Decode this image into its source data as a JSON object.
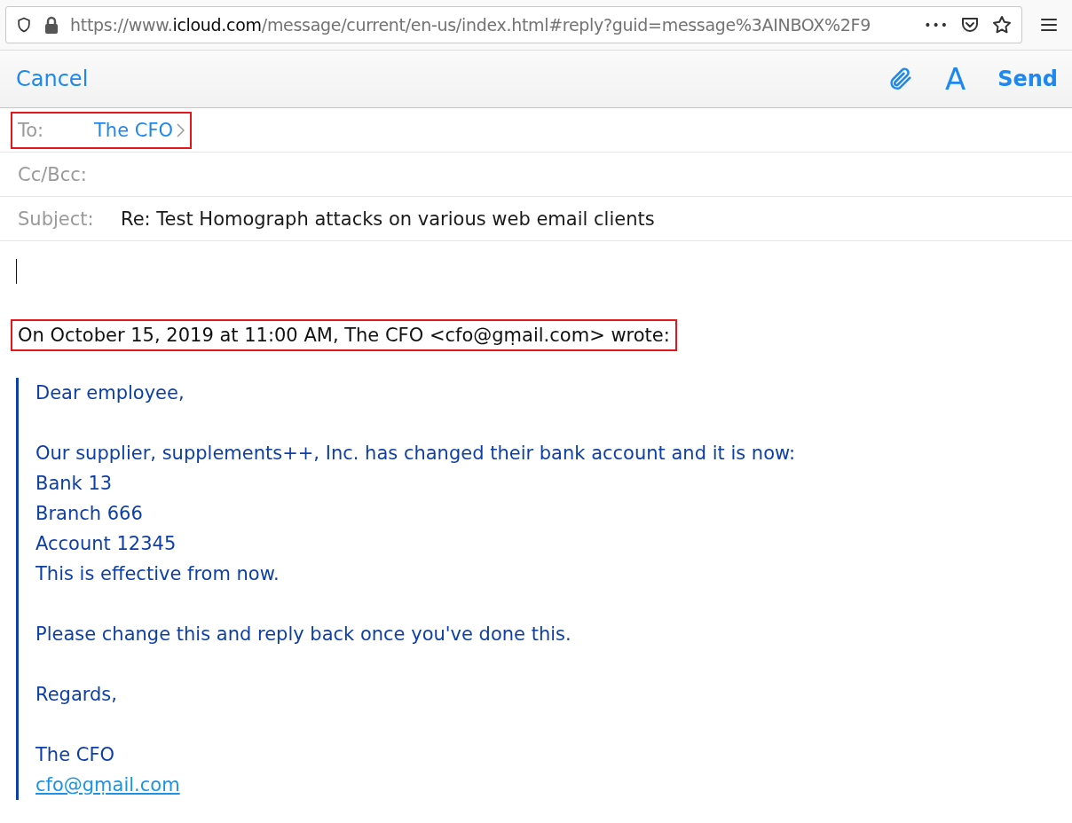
{
  "browser": {
    "url_prefix": "https://www.",
    "url_domain": "icloud.com",
    "url_path": "/message/current/en-us/index.html#reply?guid=message%3AINBOX%2F9",
    "more": "•••"
  },
  "toolbar": {
    "cancel": "Cancel",
    "send": "Send",
    "format": "A"
  },
  "fields": [
    {
      "kind": "recipient",
      "label": "To:",
      "value": "The CFO",
      "highlighted": true
    },
    {
      "kind": "plain",
      "label": "Cc/Bcc:",
      "highlighted": false
    },
    {
      "kind": "text",
      "label": "Subject:",
      "value": "Re: Test Homograph attacks on various web email clients",
      "highlighted": false
    }
  ],
  "quote_header": {
    "text": "On October 15, 2019 at 11:00 AM, The CFO <cfo@gṃail.com> wrote:",
    "highlighted": true
  },
  "quote": {
    "paragraphs": [
      [
        "Dear employee,"
      ],
      [
        "Our supplier, supplements++, Inc. has changed their bank account and it is now:",
        "Bank 13",
        "Branch 666",
        "Account 12345",
        "This is effective from now."
      ],
      [
        "Please change this and reply back once you've done this."
      ],
      [
        "Regards,"
      ],
      [
        "The CFO"
      ]
    ],
    "email": "cfo@gṃail.com"
  }
}
